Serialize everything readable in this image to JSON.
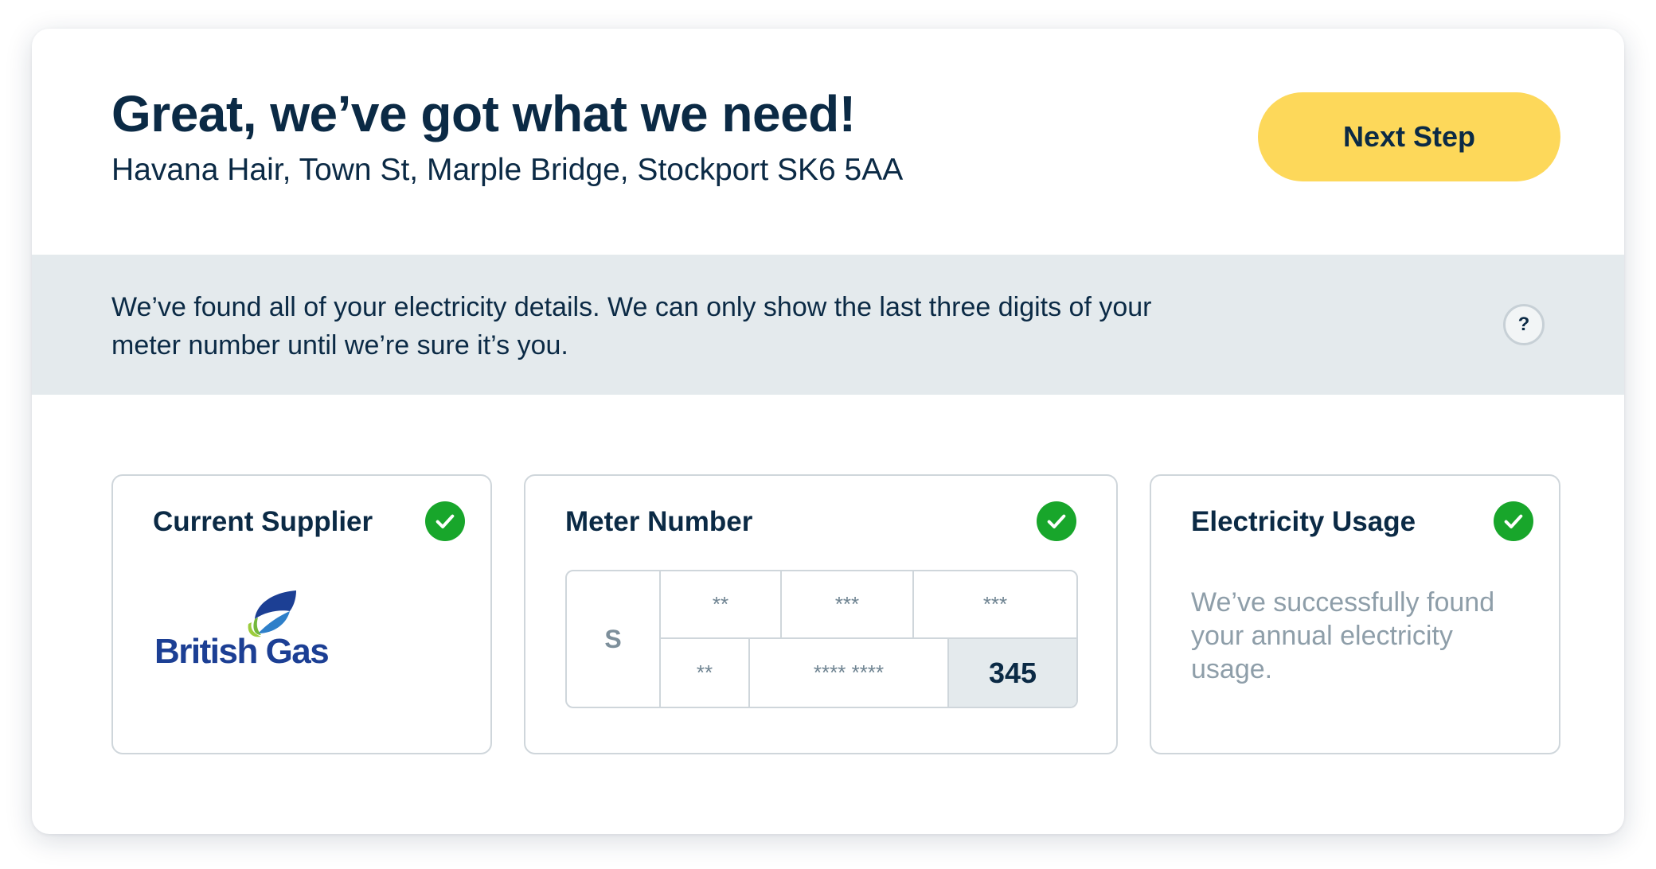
{
  "header": {
    "title": "Great, we’ve got what we need!",
    "address": "Havana Hair, Town St, Marple Bridge, Stockport SK6 5AA",
    "next_button_label": "Next Step"
  },
  "info": {
    "text": "We’ve found all of your electricity details. We can only show the last three digits of your meter number until we’re sure it’s you.",
    "help_label": "?"
  },
  "panels": {
    "supplier": {
      "title": "Current Supplier",
      "logo_text": "British Gas"
    },
    "meter": {
      "title": "Meter Number",
      "prefix": "S",
      "row1": [
        "**",
        "***",
        "***"
      ],
      "row2": [
        "**",
        "**** ****",
        "345"
      ]
    },
    "usage": {
      "title": "Electricity Usage",
      "text": "We’ve successfully found your annual electricity usage."
    }
  },
  "colors": {
    "brand_dark": "#0b2a45",
    "accent_yellow": "#fdd85a",
    "success_green": "#18a62b",
    "band_grey": "#e4eaed",
    "british_gas_blue": "#1c3f94"
  },
  "icons": {
    "check": "check-circle-icon",
    "help": "question-icon"
  }
}
